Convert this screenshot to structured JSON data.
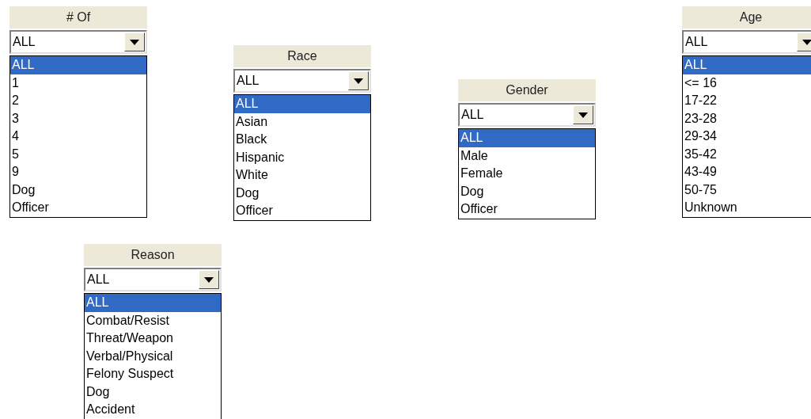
{
  "filters": [
    {
      "title": "# Of",
      "value": "ALL",
      "options": [
        {
          "label": "ALL",
          "selected": true
        },
        {
          "label": "1",
          "selected": false
        },
        {
          "label": "2",
          "selected": false
        },
        {
          "label": "3",
          "selected": false
        },
        {
          "label": "4",
          "selected": false
        },
        {
          "label": "5",
          "selected": false
        },
        {
          "label": "9",
          "selected": false
        },
        {
          "label": "Dog",
          "selected": false
        },
        {
          "label": "Officer",
          "selected": false
        }
      ]
    },
    {
      "title": "Race",
      "value": "ALL",
      "options": [
        {
          "label": "ALL",
          "selected": true
        },
        {
          "label": "Asian",
          "selected": false
        },
        {
          "label": "Black",
          "selected": false
        },
        {
          "label": "Hispanic",
          "selected": false
        },
        {
          "label": "White",
          "selected": false
        },
        {
          "label": "Dog",
          "selected": false
        },
        {
          "label": "Officer",
          "selected": false
        }
      ]
    },
    {
      "title": "Gender",
      "value": "ALL",
      "options": [
        {
          "label": "ALL",
          "selected": true
        },
        {
          "label": "Male",
          "selected": false
        },
        {
          "label": "Female",
          "selected": false
        },
        {
          "label": "Dog",
          "selected": false
        },
        {
          "label": "Officer",
          "selected": false
        }
      ]
    },
    {
      "title": "Age",
      "value": "ALL",
      "options": [
        {
          "label": "ALL",
          "selected": true
        },
        {
          "label": "<= 16",
          "selected": false
        },
        {
          "label": "17-22",
          "selected": false
        },
        {
          "label": "23-28",
          "selected": false
        },
        {
          "label": "29-34",
          "selected": false
        },
        {
          "label": "35-42",
          "selected": false
        },
        {
          "label": "43-49",
          "selected": false
        },
        {
          "label": "50-75",
          "selected": false
        },
        {
          "label": "Unknown",
          "selected": false
        }
      ]
    },
    {
      "title": "Reason",
      "value": "ALL",
      "options": [
        {
          "label": "ALL",
          "selected": true
        },
        {
          "label": "Combat/Resist",
          "selected": false
        },
        {
          "label": "Threat/Weapon",
          "selected": false
        },
        {
          "label": "Verbal/Physical",
          "selected": false
        },
        {
          "label": "Felony Suspect",
          "selected": false
        },
        {
          "label": "Dog",
          "selected": false
        },
        {
          "label": "Accident",
          "selected": false
        }
      ]
    }
  ]
}
